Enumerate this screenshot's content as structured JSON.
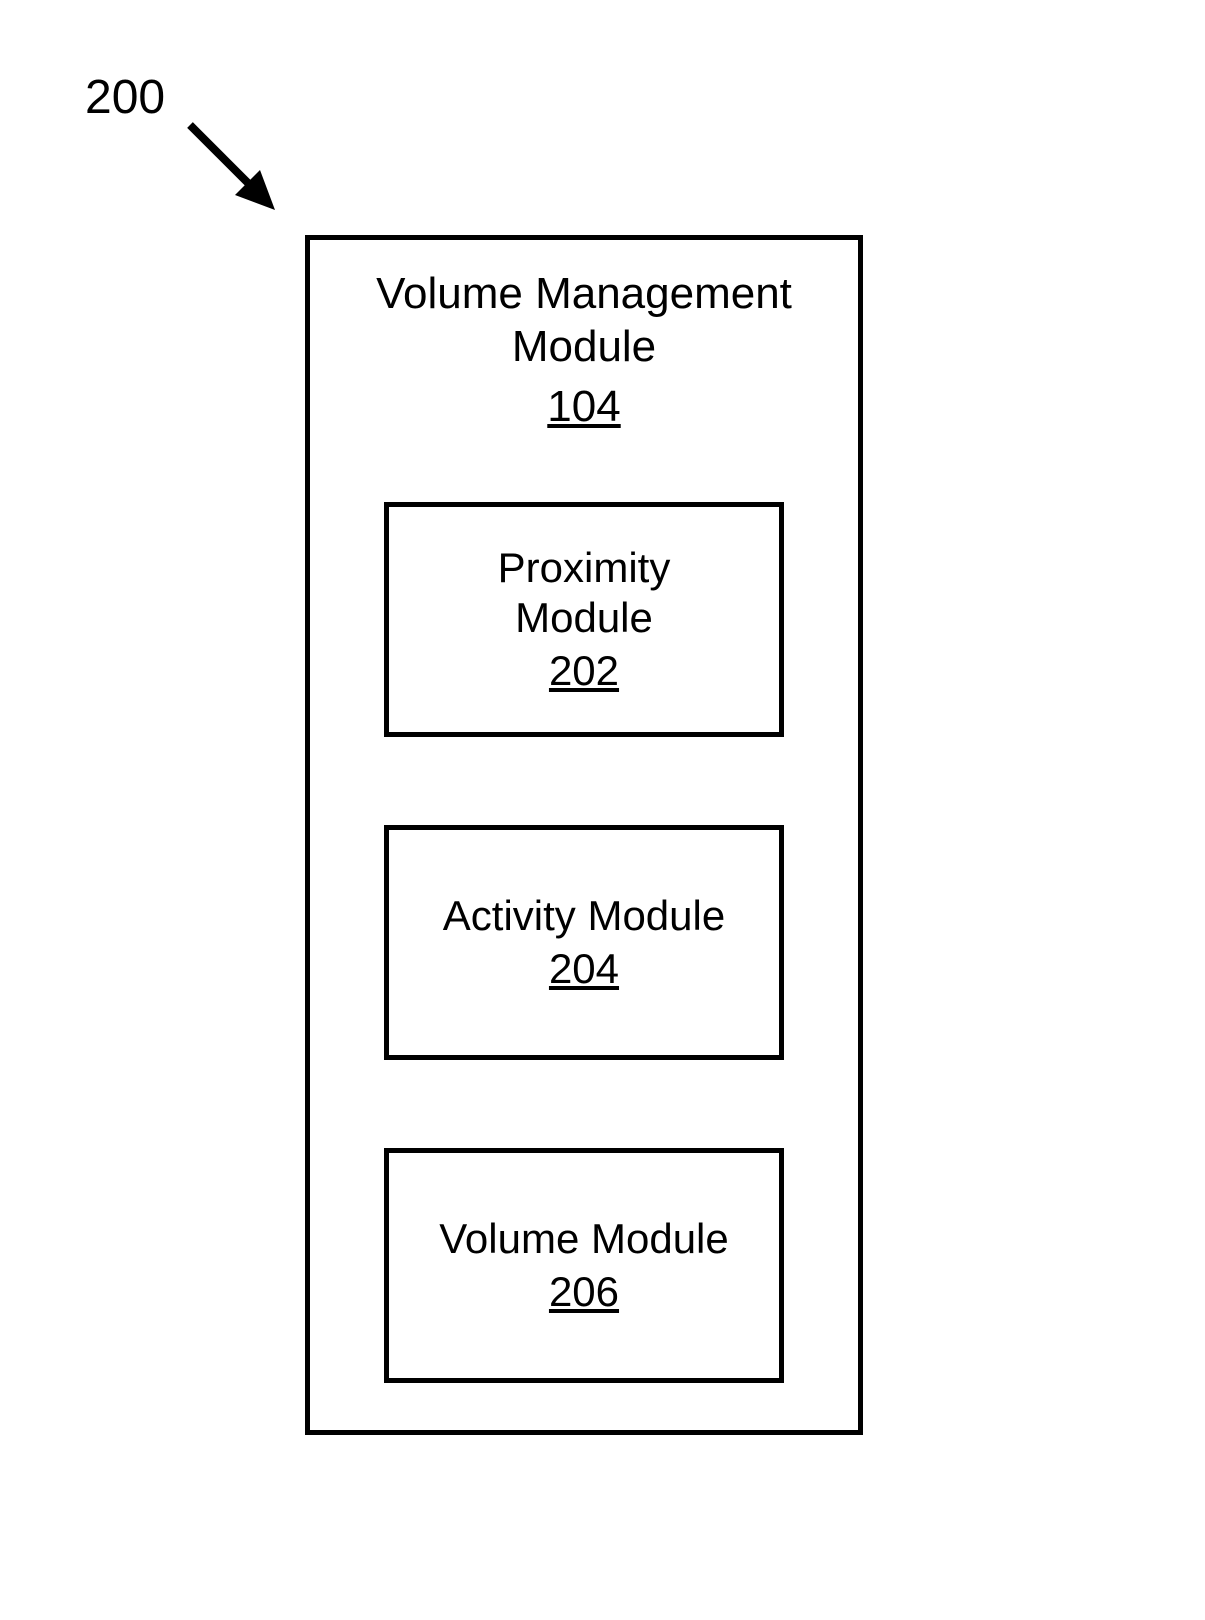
{
  "figure": {
    "label": "200"
  },
  "main": {
    "title_line1": "Volume Management",
    "title_line2": "Module",
    "ref": "104"
  },
  "modules": [
    {
      "title_line1": "Proximity",
      "title_line2": "Module",
      "ref": "202"
    },
    {
      "title_line1": "Activity Module",
      "title_line2": "",
      "ref": "204"
    },
    {
      "title_line1": "Volume Module",
      "title_line2": "",
      "ref": "206"
    }
  ]
}
